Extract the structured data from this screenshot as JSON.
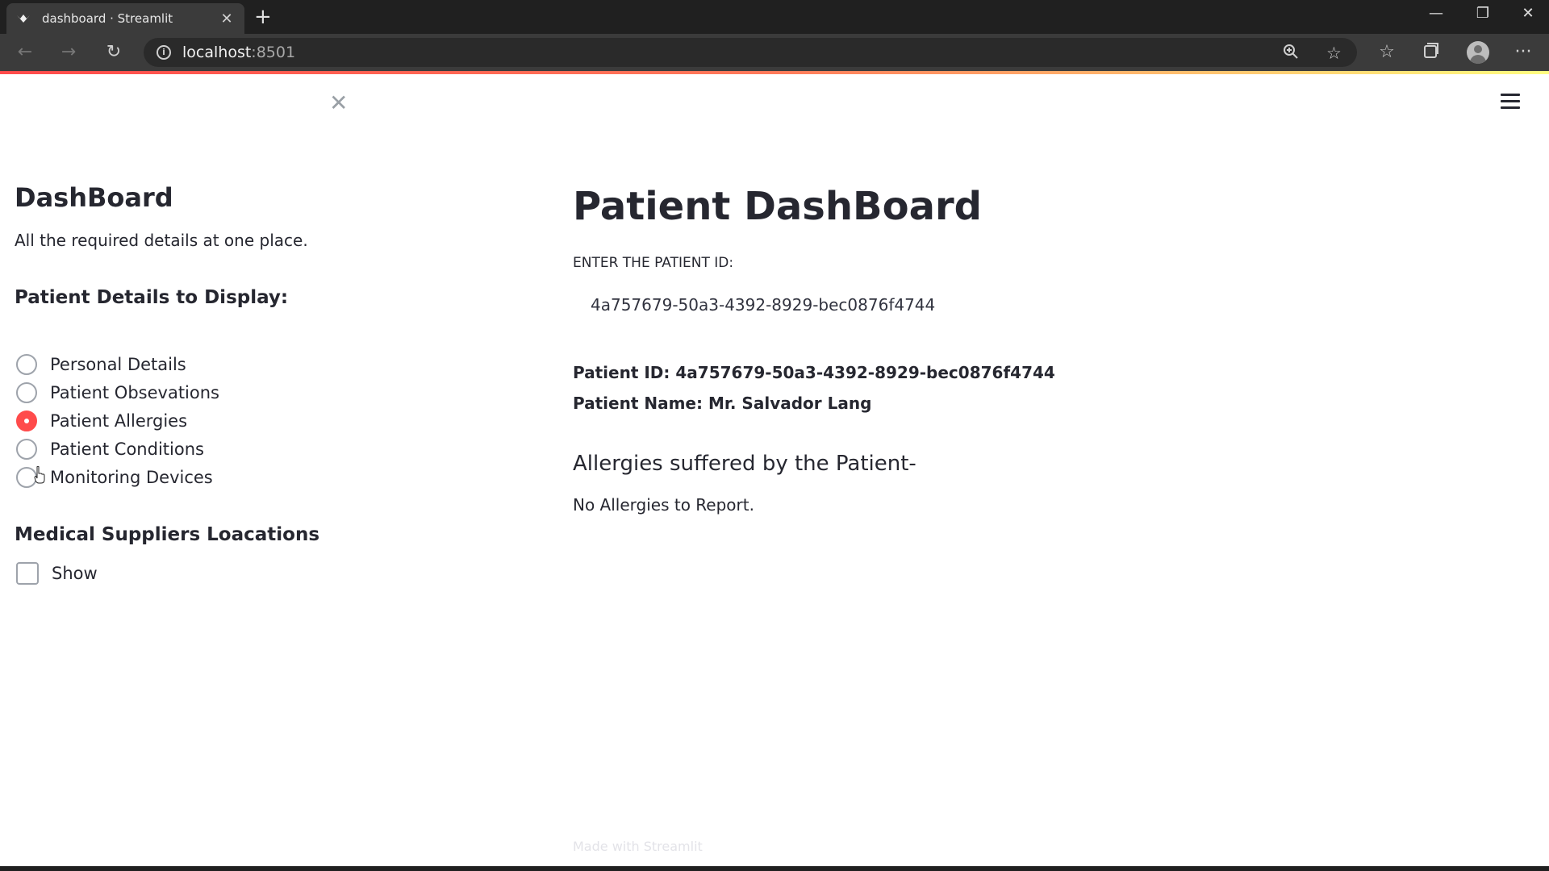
{
  "browser": {
    "tab_title": "dashboard · Streamlit",
    "tab_close": "✕",
    "new_tab": "+",
    "address_host": "localhost",
    "address_port": ":8501",
    "window_controls": {
      "minimize": "—",
      "restore": "❐",
      "close": "✕"
    }
  },
  "sidebar": {
    "close": "✕",
    "title": "DashBoard",
    "subtitle": "All the required details at one place.",
    "details_heading": "Patient Details to Display:",
    "options": [
      {
        "label": "Personal Details",
        "selected": false
      },
      {
        "label": "Patient Obsevations",
        "selected": false
      },
      {
        "label": "Patient Allergies",
        "selected": true
      },
      {
        "label": "Patient Conditions",
        "selected": false
      },
      {
        "label": "Monitoring Devices",
        "selected": false
      }
    ],
    "suppliers_heading": "Medical Suppliers Loacations",
    "show_checkbox_label": "Show"
  },
  "main": {
    "title": "Patient DashBoard",
    "input_label": "ENTER THE PATIENT ID:",
    "input_value": "4a757679-50a3-4392-8929-bec0876f4744",
    "patient_id_line": "Patient ID: 4a757679-50a3-4392-8929-bec0876f4744",
    "patient_name_line": "Patient Name: Mr. Salvador Lang",
    "allergies_heading": "Allergies suffered by the Patient-",
    "allergies_text": "No Allergies to Report.",
    "footer": "Made with Streamlit"
  },
  "colors": {
    "accent": "#ff4b4b",
    "text": "#262730",
    "browser_bg": "#202020",
    "toolbar_bg": "#3b3b3b"
  }
}
